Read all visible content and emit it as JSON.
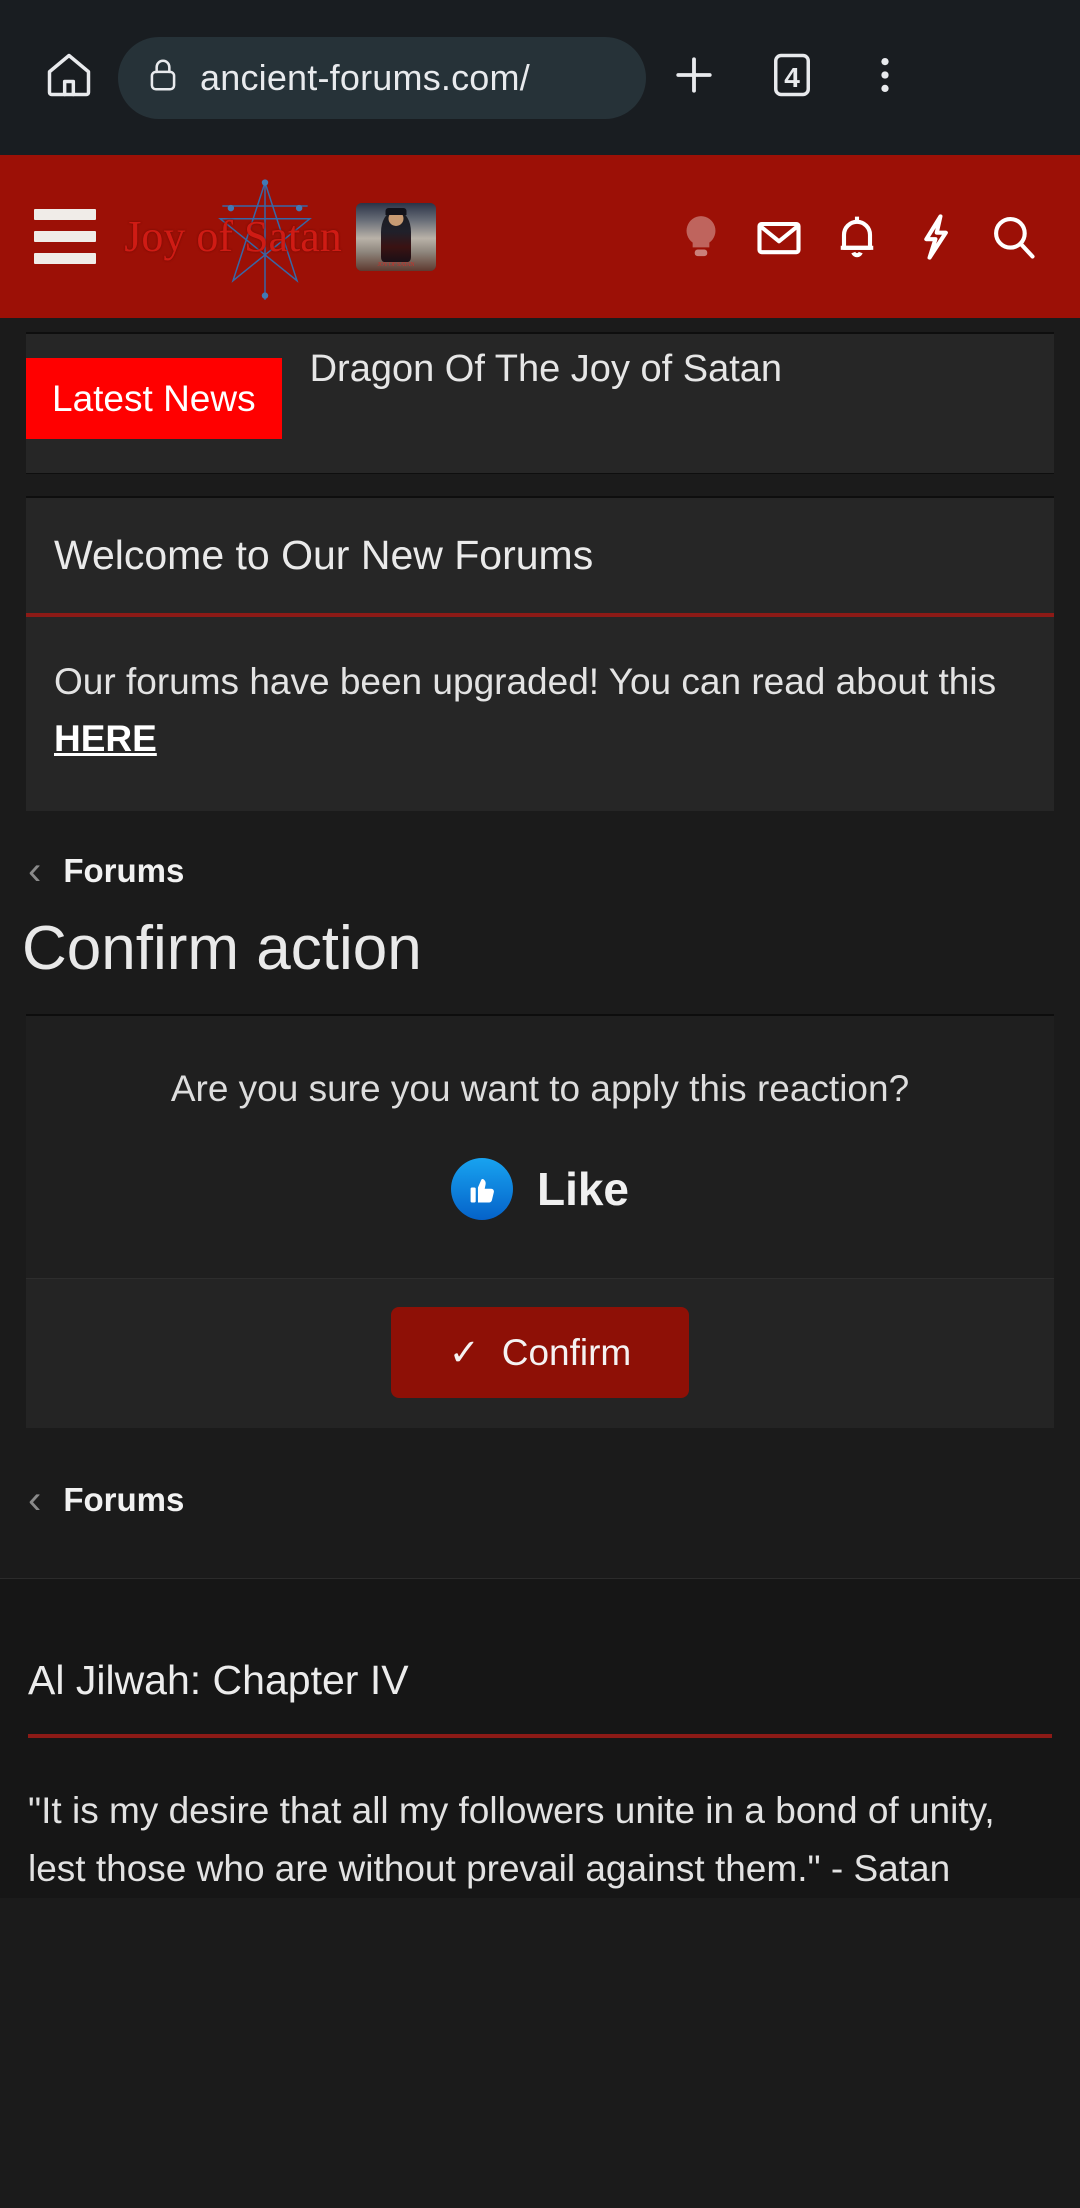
{
  "browser": {
    "home_icon": "home-icon",
    "lock_icon": "lock-icon",
    "url": "ancient-forums.com/",
    "new_tab_icon": "plus-icon",
    "tab_count": "4",
    "overflow_icon": "more-vertical-icon"
  },
  "forum_header": {
    "menu_icon": "hamburger-menu-icon",
    "logo_text": "Joy of Satan",
    "logo_sigil": "pentagram-sigil-icon",
    "avatar_banner": "site-banner-image",
    "icons": [
      {
        "name": "lightbulb-icon",
        "label": "Light mode"
      },
      {
        "name": "envelope-icon",
        "label": "Inbox"
      },
      {
        "name": "bell-icon",
        "label": "Alerts"
      },
      {
        "name": "lightning-bolt-icon",
        "label": "Whats new"
      },
      {
        "name": "search-icon",
        "label": "Search"
      }
    ]
  },
  "latest_news": {
    "badge": "Latest News",
    "headline": "Free Donor Article: My Mission & The Great Dragon Of The Joy of Satan"
  },
  "notice": {
    "title": "Welcome to Our New Forums",
    "body_before": "Our forums have been upgraded! You can read about this ",
    "link": "HERE"
  },
  "breadcrumb_top": {
    "chevron": "‹",
    "label": "Forums"
  },
  "page_title": "Confirm action",
  "confirm": {
    "question": "Are you sure you want to apply this reaction?",
    "reaction_icon": "thumbs-up-icon",
    "reaction_label": "Like",
    "reaction_color": "#1b9df0",
    "button_check": "✓",
    "button_label": "Confirm",
    "button_color": "#8e1006"
  },
  "breadcrumb_bottom": {
    "chevron": "‹",
    "label": "Forums"
  },
  "footer": {
    "title": "Al Jilwah: Chapter IV",
    "quote": "\"It is my desire that all my followers unite in a bond of unity, lest those who are without prevail against them.\" - Satan"
  },
  "colors": {
    "brand_red": "#9c1006",
    "news_red": "#ff0000",
    "accent_rule": "#8c1a16",
    "page_bg": "#1b1b1b"
  }
}
